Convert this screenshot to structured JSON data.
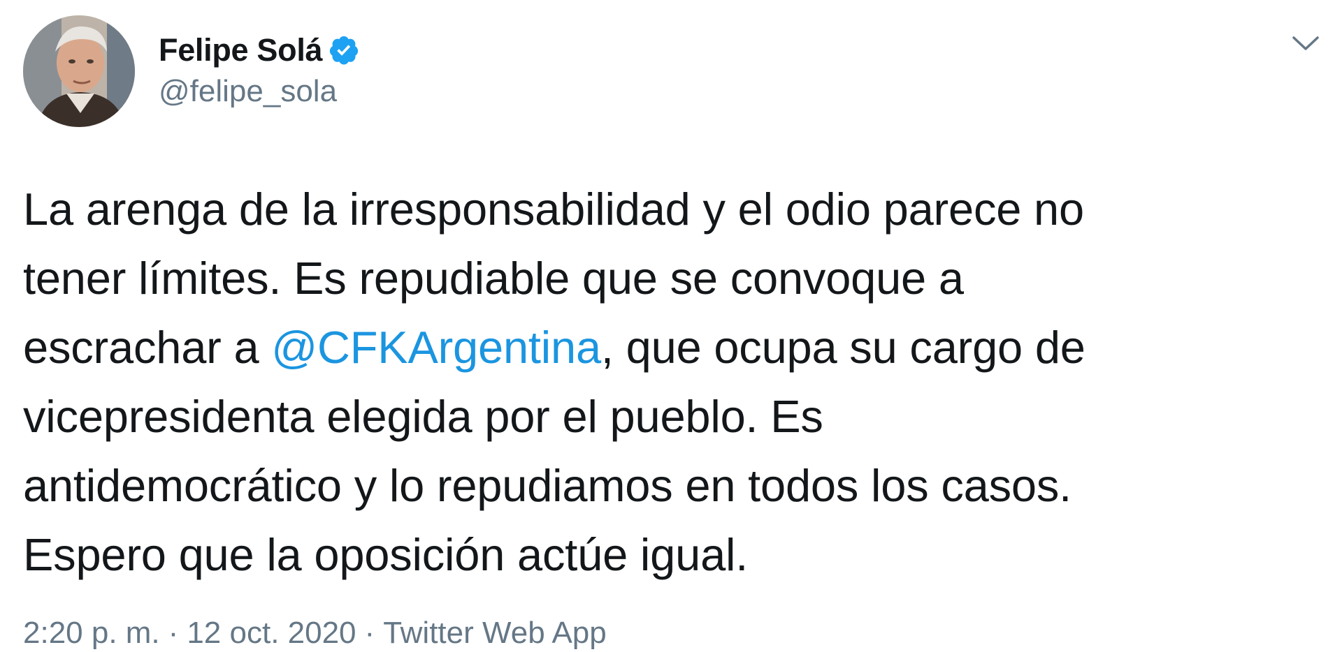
{
  "user": {
    "display_name": "Felipe Solá",
    "handle": "@felipe_sola",
    "verified_icon": "verified-badge-icon",
    "verified_color": "#1da1f2"
  },
  "menu": {
    "icon": "chevron-down-icon"
  },
  "tweet": {
    "lines": [
      {
        "before": "La arenga de la irresponsabilidad y el odio parece no",
        "mention": "",
        "after": ""
      },
      {
        "before": "tener límites. Es repudiable que se convoque a",
        "mention": "",
        "after": ""
      },
      {
        "before": "escrachar a ",
        "mention": "@CFKArgentina",
        "after": ", que ocupa su cargo de"
      },
      {
        "before": "vicepresidenta elegida por el pueblo. Es",
        "mention": "",
        "after": ""
      },
      {
        "before": "antidemocrático y lo repudiamos en todos los casos.",
        "mention": "",
        "after": ""
      },
      {
        "before": "Espero que la oposición actúe igual.",
        "mention": "",
        "after": ""
      }
    ],
    "mention_color": "#1b95e0"
  },
  "meta": {
    "time": "2:20 p. m.",
    "separator": "·",
    "date": "12 oct. 2020",
    "source": "Twitter Web App"
  }
}
